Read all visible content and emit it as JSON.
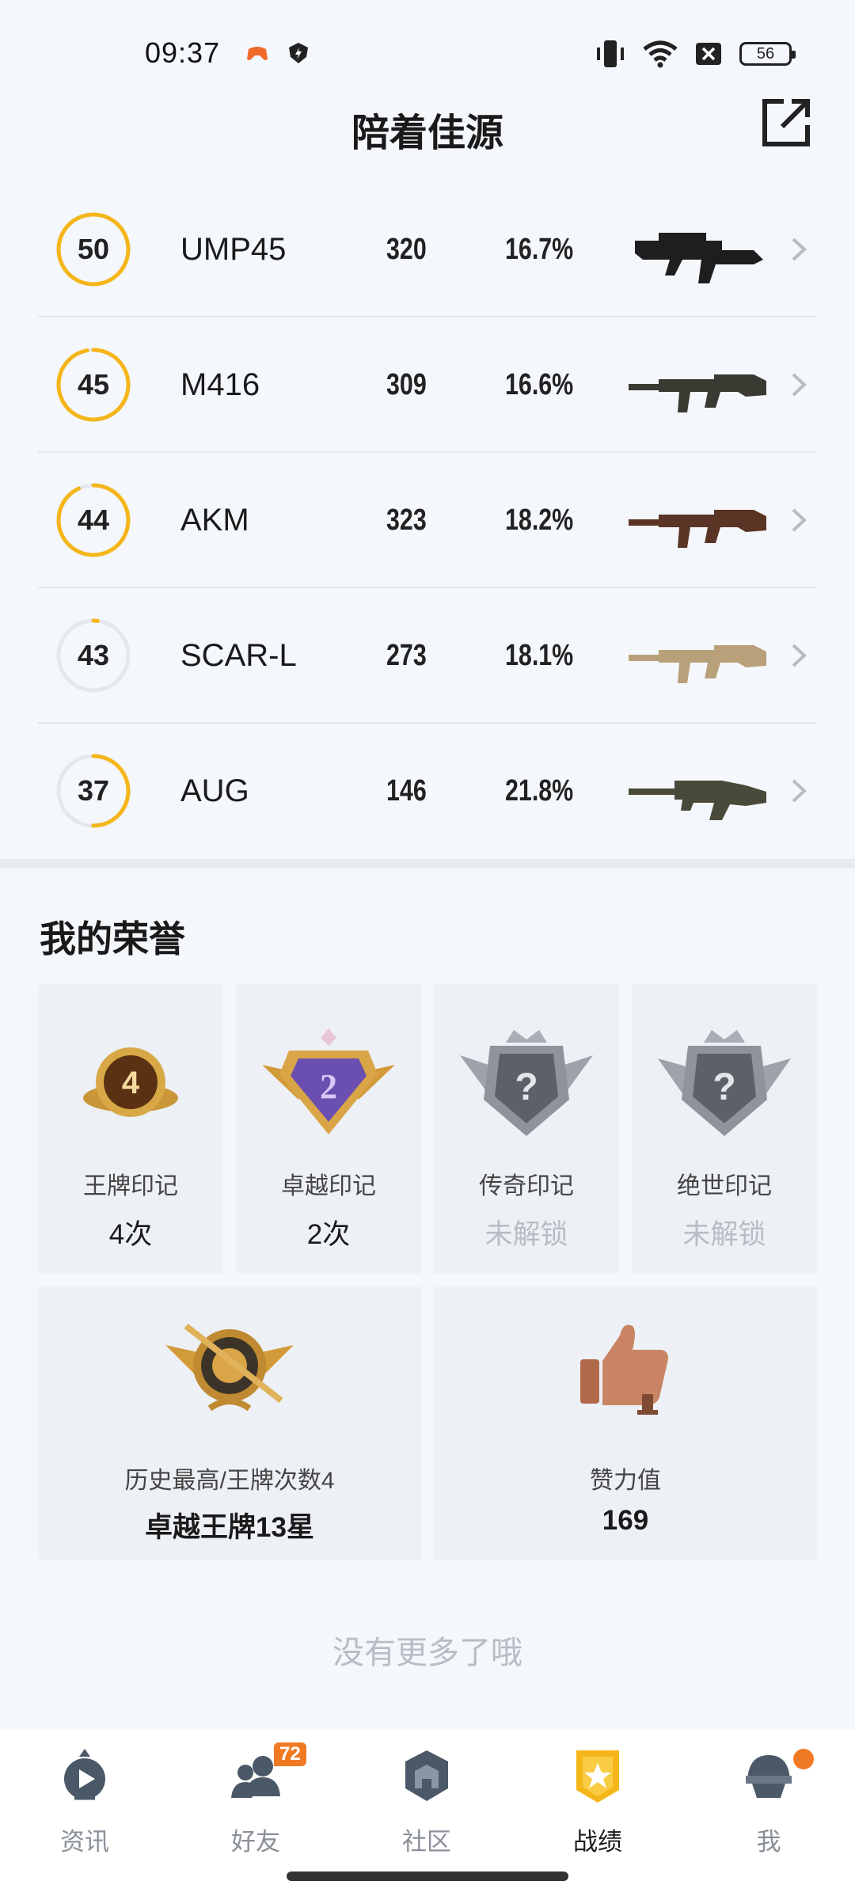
{
  "status_bar": {
    "time": "09:37",
    "battery": "56",
    "icons": [
      "game-controller-icon",
      "shield-app-icon",
      "vibrate-icon",
      "wifi-icon",
      "sim-off-icon",
      "battery-icon"
    ]
  },
  "header": {
    "title": "陪着佳源",
    "share_icon": "share-external-icon"
  },
  "weapons": [
    {
      "level": "50",
      "ring_progress": 1.0,
      "name": "UMP45",
      "kills": "320",
      "rate": "16.7%",
      "image": "smg-image"
    },
    {
      "level": "45",
      "ring_progress": 0.97,
      "name": "M416",
      "kills": "309",
      "rate": "16.6%",
      "image": "assault-rifle-image"
    },
    {
      "level": "44",
      "ring_progress": 0.93,
      "name": "AKM",
      "kills": "323",
      "rate": "18.2%",
      "image": "assault-rifle-image"
    },
    {
      "level": "43",
      "ring_progress": 0.02,
      "name": "SCAR-L",
      "kills": "273",
      "rate": "18.1%",
      "image": "assault-rifle-image"
    },
    {
      "level": "37",
      "ring_progress": 0.5,
      "name": "AUG",
      "kills": "146",
      "rate": "21.8%",
      "image": "bullpup-rifle-image"
    }
  ],
  "honors": {
    "title": "我的荣誉",
    "marks": [
      {
        "label": "王牌印记",
        "value": "4次",
        "locked": false,
        "badge_text": "4",
        "icon": "ace-mark-icon"
      },
      {
        "label": "卓越印记",
        "value": "2次",
        "locked": false,
        "badge_text": "2",
        "icon": "excellence-mark-icon"
      },
      {
        "label": "传奇印记",
        "value": "未解锁",
        "locked": true,
        "badge_text": "?",
        "icon": "legend-mark-icon"
      },
      {
        "label": "绝世印记",
        "value": "未解锁",
        "locked": true,
        "badge_text": "?",
        "icon": "peerless-mark-icon"
      }
    ],
    "highest": {
      "label": "历史最高/王牌次数4",
      "value": "卓越王牌13星",
      "icon": "rank-emblem-icon"
    },
    "likes": {
      "label": "赞力值",
      "value": "169",
      "icon": "thumbs-up-icon"
    }
  },
  "footer_text": "没有更多了哦",
  "nav": {
    "items": [
      {
        "label": "资讯",
        "icon": "news-play-icon",
        "active": false
      },
      {
        "label": "好友",
        "icon": "friends-icon",
        "active": false,
        "badge": "72"
      },
      {
        "label": "社区",
        "icon": "community-icon",
        "active": false
      },
      {
        "label": "战绩",
        "icon": "record-badge-icon",
        "active": true
      },
      {
        "label": "我",
        "icon": "profile-helmet-icon",
        "active": false,
        "dot": true
      }
    ]
  },
  "colors": {
    "accent": "#f5b61a",
    "ring_track": "#e4e8ee",
    "badge": "#f07a23",
    "text_locked": "#b8bcc4"
  }
}
